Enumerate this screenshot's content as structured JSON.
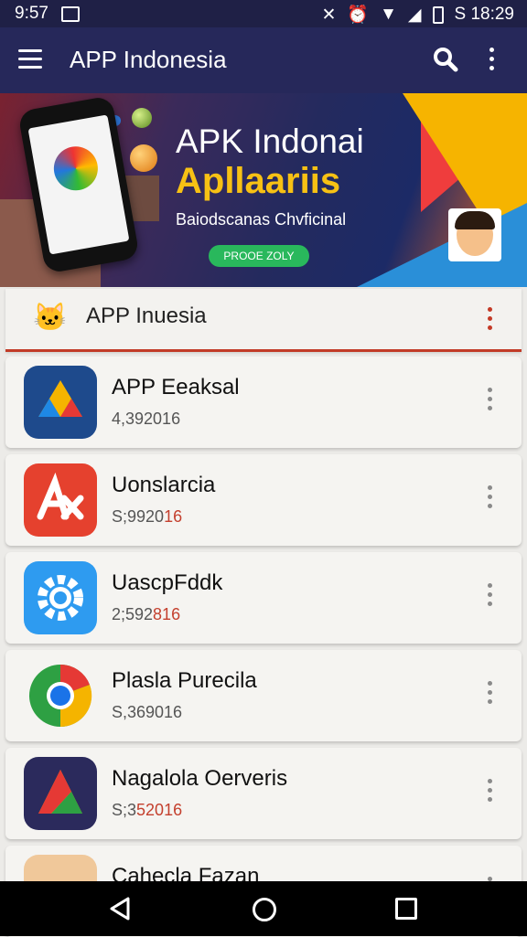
{
  "status": {
    "time_left": "9:57",
    "time_right": "S 18:29"
  },
  "appbar": {
    "title": "APP Indonesia"
  },
  "banner": {
    "title": "APK Indonai",
    "title2": "Apllaariis",
    "subtitle": "Baiodscanas Chvficinal",
    "cta": "PROOE ZOLY"
  },
  "section": {
    "title": "APP Inuesia"
  },
  "apps": [
    {
      "name": "APP Eeaksal",
      "sub": "4,392016",
      "sub_hl": ""
    },
    {
      "name": "Uonslarcia",
      "sub": "S;9920",
      "sub_hl": "16"
    },
    {
      "name": "UascpFddk",
      "sub": "2;592",
      "sub_hl": "816"
    },
    {
      "name": "Plasla Purecila",
      "sub": "S,369016",
      "sub_hl": ""
    },
    {
      "name": "Nagalola Oerveris",
      "sub": "S;3",
      "sub_hl": "52016"
    },
    {
      "name": "Cahecla Fazan",
      "sub": "",
      "sub_hl": ""
    }
  ],
  "colors": {
    "appbar": "#26285a",
    "accent": "#c23b27",
    "cta": "#29b85c"
  }
}
